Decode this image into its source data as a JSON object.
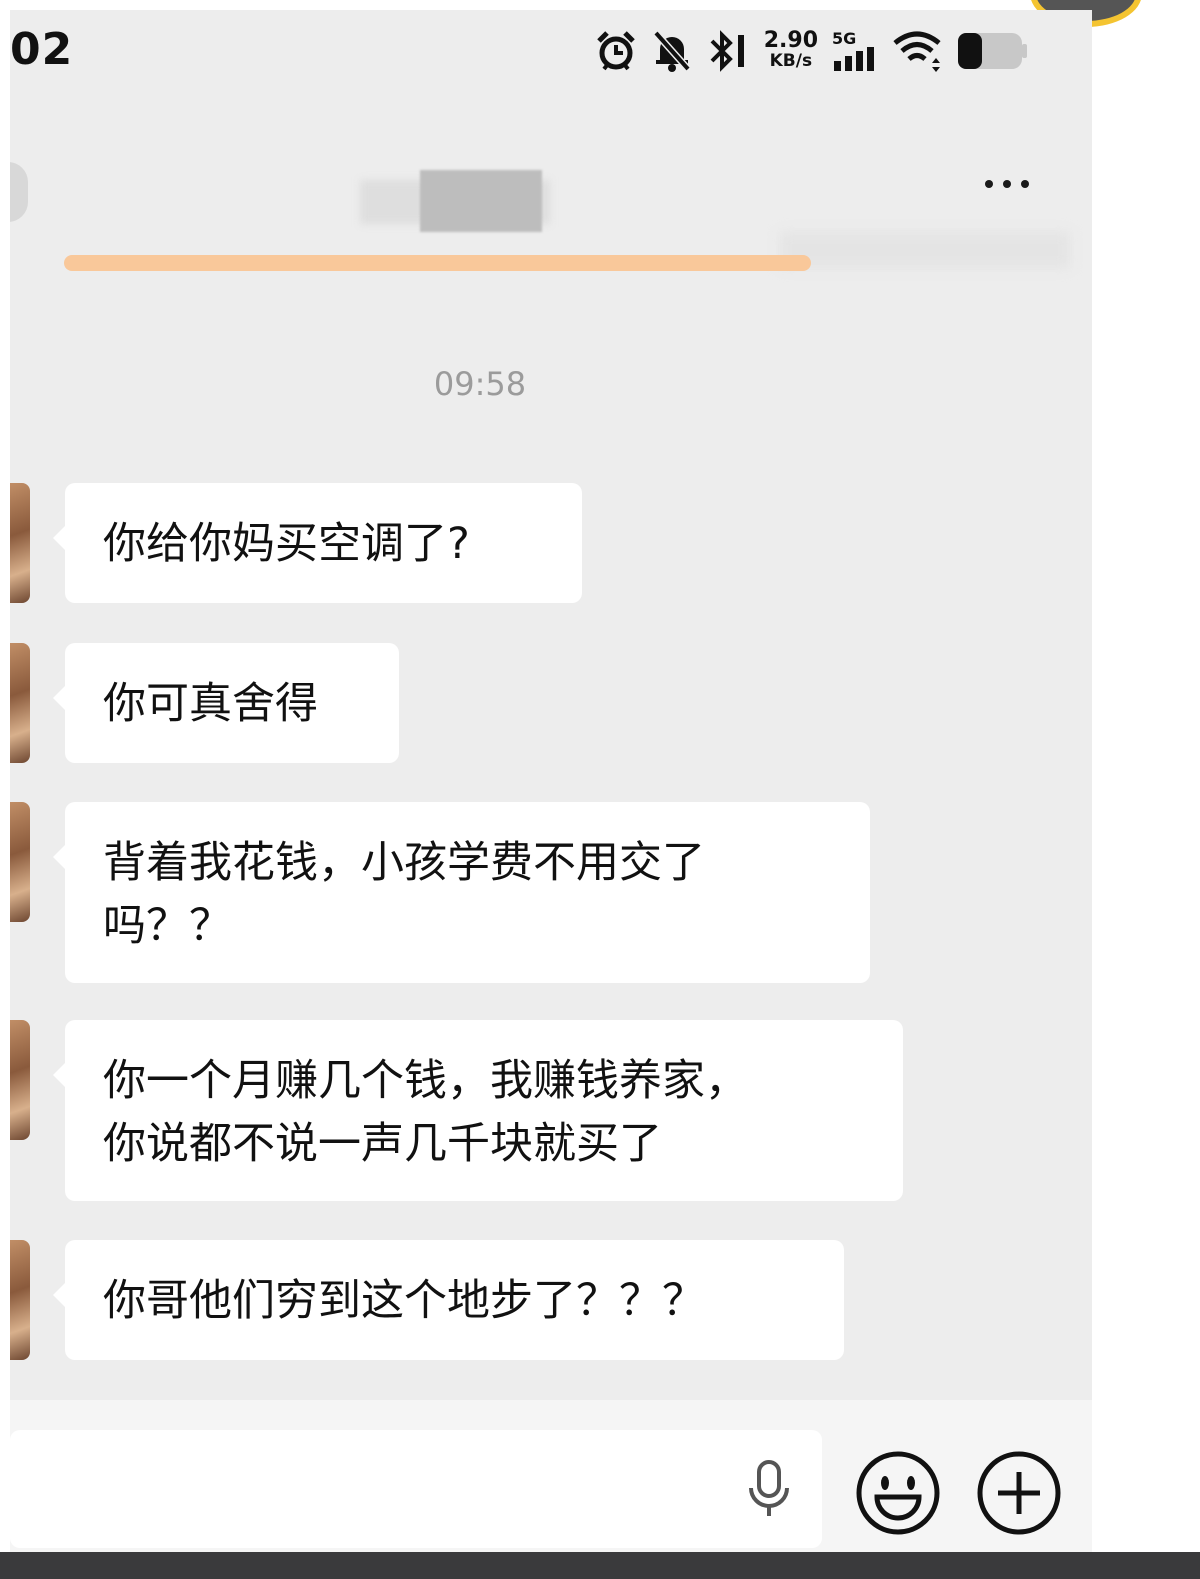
{
  "status_bar": {
    "time": "02",
    "net_speed_value": "2.90",
    "net_speed_unit": "KB/s",
    "network": "5G",
    "icons": [
      "alarm-icon",
      "mute-icon",
      "bluetooth-icon",
      "signal-icon",
      "wifi-icon",
      "battery-icon"
    ],
    "battery_level": 0.35
  },
  "header": {
    "more_icon": "more-dots-icon"
  },
  "chat": {
    "timestamp": "09:58",
    "messages": [
      {
        "lines": [
          "你给你妈买空调了?"
        ]
      },
      {
        "lines": [
          "你可真舍得"
        ]
      },
      {
        "lines": [
          "背着我花钱，小孩学费不用交了",
          "吗？？"
        ]
      },
      {
        "lines": [
          "你一个月赚几个钱，我赚钱养家，",
          "你说都不说一声几千块就买了"
        ]
      },
      {
        "lines": [
          "你哥他们穷到这个地步了？？？"
        ]
      }
    ]
  },
  "input_bar": {
    "placeholder": "",
    "icons": [
      "microphone-icon",
      "emoji-icon",
      "plus-icon"
    ]
  },
  "colors": {
    "background": "#ededed",
    "bubble": "#ffffff",
    "accent_bar": "#f9c89a"
  }
}
